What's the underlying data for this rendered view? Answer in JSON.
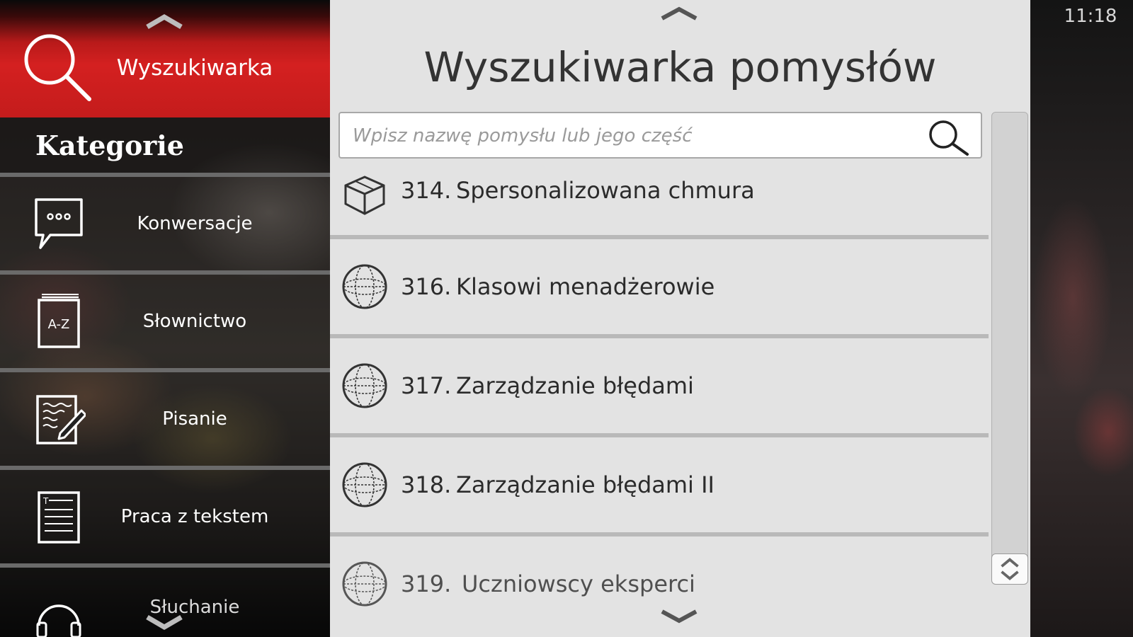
{
  "status_bar": {
    "time": "11:18"
  },
  "sidebar": {
    "header_label": "Wyszukiwarka",
    "categories_title": "Kategorie",
    "items": [
      {
        "label": "Konwersacje",
        "icon": "speech-bubble-icon"
      },
      {
        "label": "Słownictwo",
        "icon": "dictionary-az-icon"
      },
      {
        "label": "Pisanie",
        "icon": "writing-pencil-icon"
      },
      {
        "label": "Praca z tekstem",
        "icon": "text-document-icon"
      },
      {
        "label": "Słuchanie",
        "icon": "headphones-icon"
      }
    ]
  },
  "main": {
    "title": "Wyszukiwarka pomysłów",
    "search_placeholder": "Wpisz nazwę pomysłu lub jego część",
    "search_value": "",
    "results": [
      {
        "number": "314.",
        "title": "Spersonalizowana chmura",
        "icon": "cube-icon"
      },
      {
        "number": "316.",
        "title": "Klasowi menadżerowie",
        "icon": "globe-icon"
      },
      {
        "number": "317.",
        "title": "Zarządzanie błędami",
        "icon": "globe-icon"
      },
      {
        "number": "318.",
        "title": "Zarządzanie błędami II",
        "icon": "globe-icon"
      },
      {
        "number": "319.",
        "title": "Uczniowscy eksperci",
        "icon": "globe-icon"
      }
    ]
  },
  "colors": {
    "accent_red": "#d42020",
    "panel_bg": "#e3e3e3",
    "text_dark": "#2b2b2b"
  }
}
